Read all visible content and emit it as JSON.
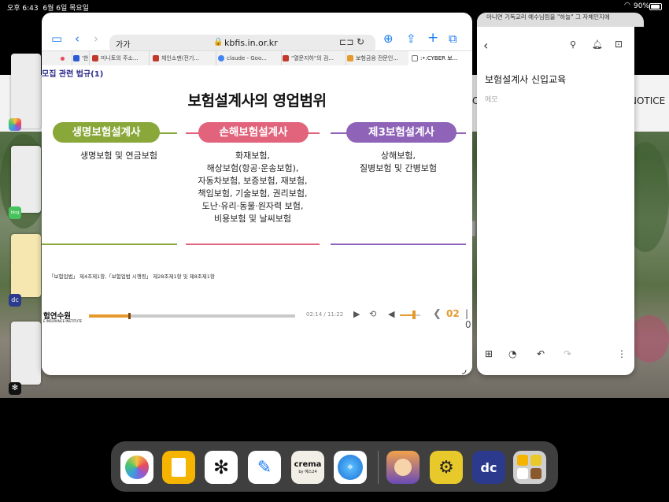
{
  "status_bar": {
    "time": "오후 6:43",
    "date": "6월 6일 목요일",
    "battery": "90%"
  },
  "wallpaper": {
    "band_text_left": "C",
    "band_text_right": "NOTICE"
  },
  "safari": {
    "address_aa": "가가",
    "url": "kbfis.in.or.kr",
    "tabs": [
      {
        "label": "'한",
        "color": "#2b5cd6",
        "active": false
      },
      {
        "label": "미니토의 주소...",
        "color": "#c0392b",
        "active": false
      },
      {
        "label": "체인소맨(전기...",
        "color": "#c0392b",
        "active": false
      },
      {
        "label": "claude - Goo...",
        "color": "#4285f4",
        "active": false
      },
      {
        "label": "\"열문지하\"의 검...",
        "color": "#c0392b",
        "active": false
      },
      {
        "label": "보험금융 전문인...",
        "color": "#e59a2e",
        "active": false
      },
      {
        "label": ":•:CYBER 보...",
        "color": "#777777",
        "active": true
      }
    ],
    "page": {
      "section_heading": "모집 관련 법규(1)",
      "title": "보험설계사의 영업범위",
      "columns": [
        {
          "heading": "생명보험설계사",
          "color": "#8aa83a",
          "lines": [
            "생명보험 및 연금보험"
          ]
        },
        {
          "heading": "손해보험설계사",
          "color": "#e2637c",
          "lines": [
            "화재보험,",
            "해상보험(항공·운송보험),",
            "자동차보험, 보증보험, 재보험,",
            "책임보험, 기술보험, 권리보험,",
            "도난·유리·동물·원자력 보험,",
            "비용보험 및 날씨보험"
          ]
        },
        {
          "heading": "제3보험설계사",
          "color": "#8e63b8",
          "lines": [
            "상해보험,",
            "질병보험 및 간병보험"
          ]
        }
      ],
      "footnote": "「보험업법」 제4조제1항,「보험업법 시행령」 제28조제1항 및 제8조제1항",
      "logo": "험연수원",
      "logo_sub": "E INSURANCE INSTITUTE",
      "player": {
        "elapsed": "02:14",
        "duration": "11:22",
        "time_display": "02:14 / 11:22",
        "progress_fraction": 0.196,
        "volume_fraction": 0.7,
        "page": "02",
        "page_sep": "| 0"
      }
    }
  },
  "notes": {
    "peek_text": "아니면 기독교리 예수님림을 \"하늘\" 그 자체인지에",
    "title": "보험설계사 신입교육",
    "placeholder": "메모"
  },
  "dock": {
    "apps": [
      "Photos",
      "Keep",
      "ChatGPT",
      "Freeform",
      "crema",
      "Safari",
      "Game1",
      "Game2",
      "dc",
      "Folder"
    ],
    "crema_label": "crema",
    "crema_sub": "by 예스24"
  }
}
